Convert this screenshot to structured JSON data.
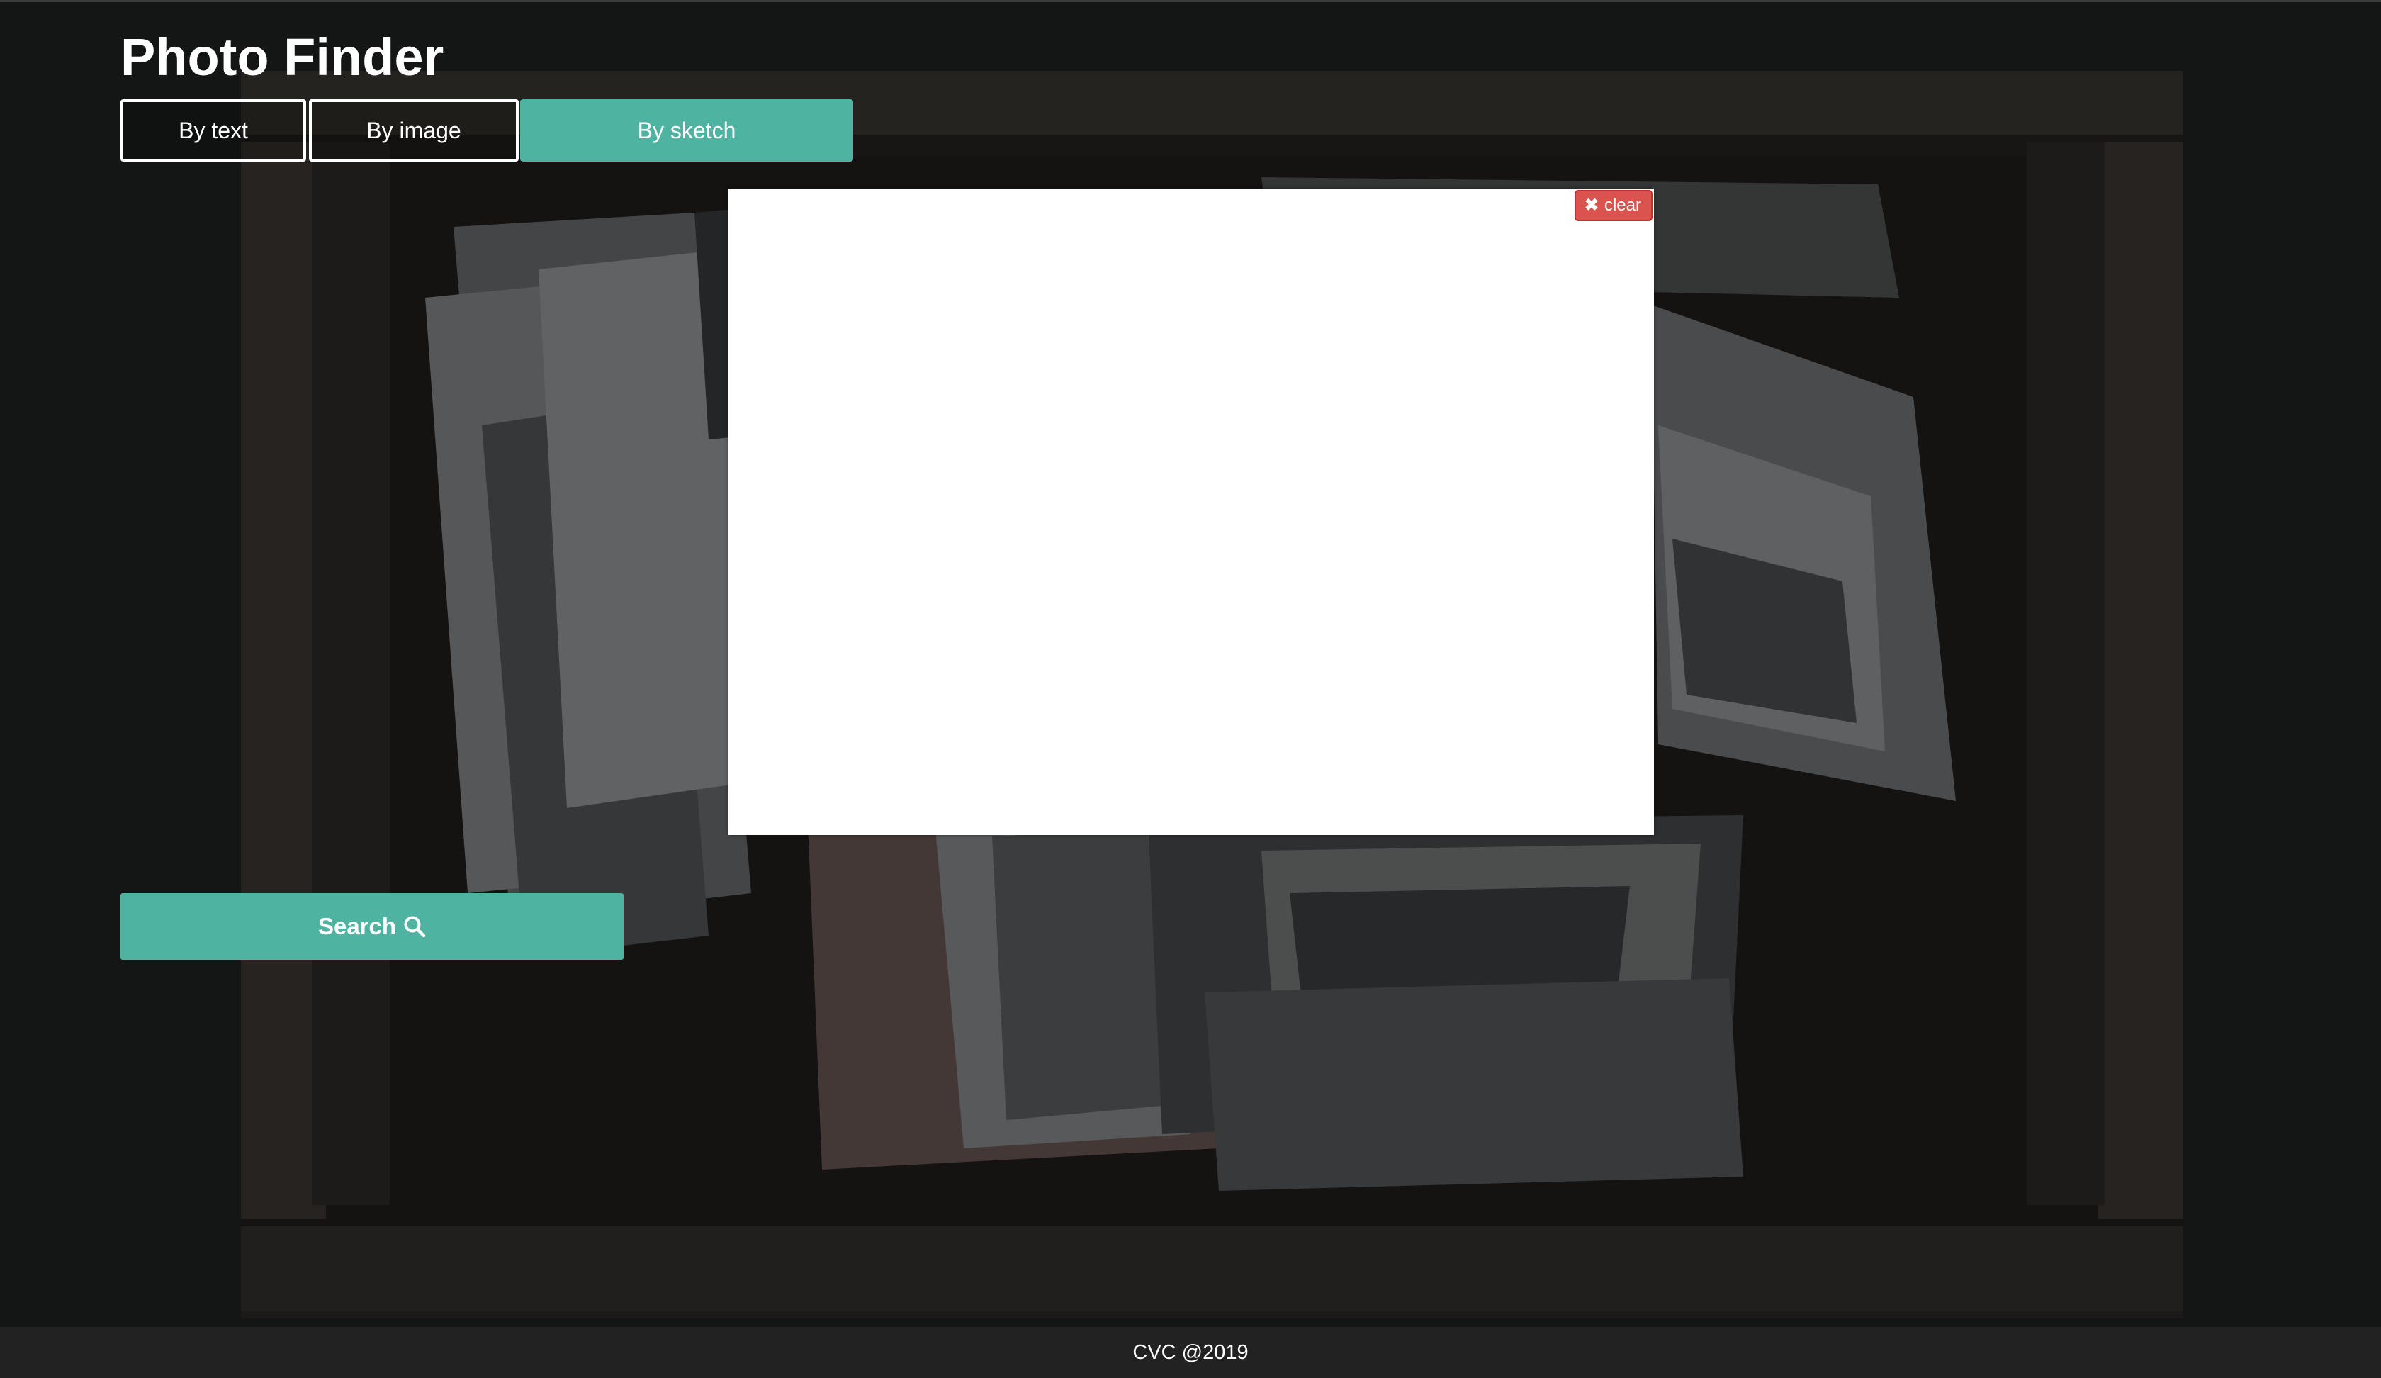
{
  "app": {
    "title": "Photo Finder"
  },
  "tabs": [
    {
      "label": "By text",
      "active": false
    },
    {
      "label": "By image",
      "active": false
    },
    {
      "label": "By sketch",
      "active": true
    }
  ],
  "canvas": {
    "clear_label": "clear",
    "clear_icon": "close-icon"
  },
  "search": {
    "label": "Search",
    "icon": "search-icon"
  },
  "footer": {
    "text": "CVC @2019"
  },
  "colors": {
    "accent": "#4fb3a2",
    "danger": "#d9534f",
    "footer_bg": "#222222",
    "text": "#ffffff"
  }
}
